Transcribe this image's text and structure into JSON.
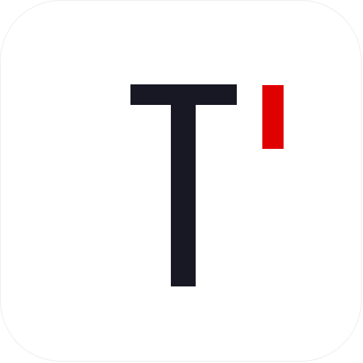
{
  "icon": {
    "symbol": "t-logo-icon",
    "colors": {
      "background": "#ffffff",
      "letter": "#181824",
      "accent": "#e00000"
    }
  }
}
